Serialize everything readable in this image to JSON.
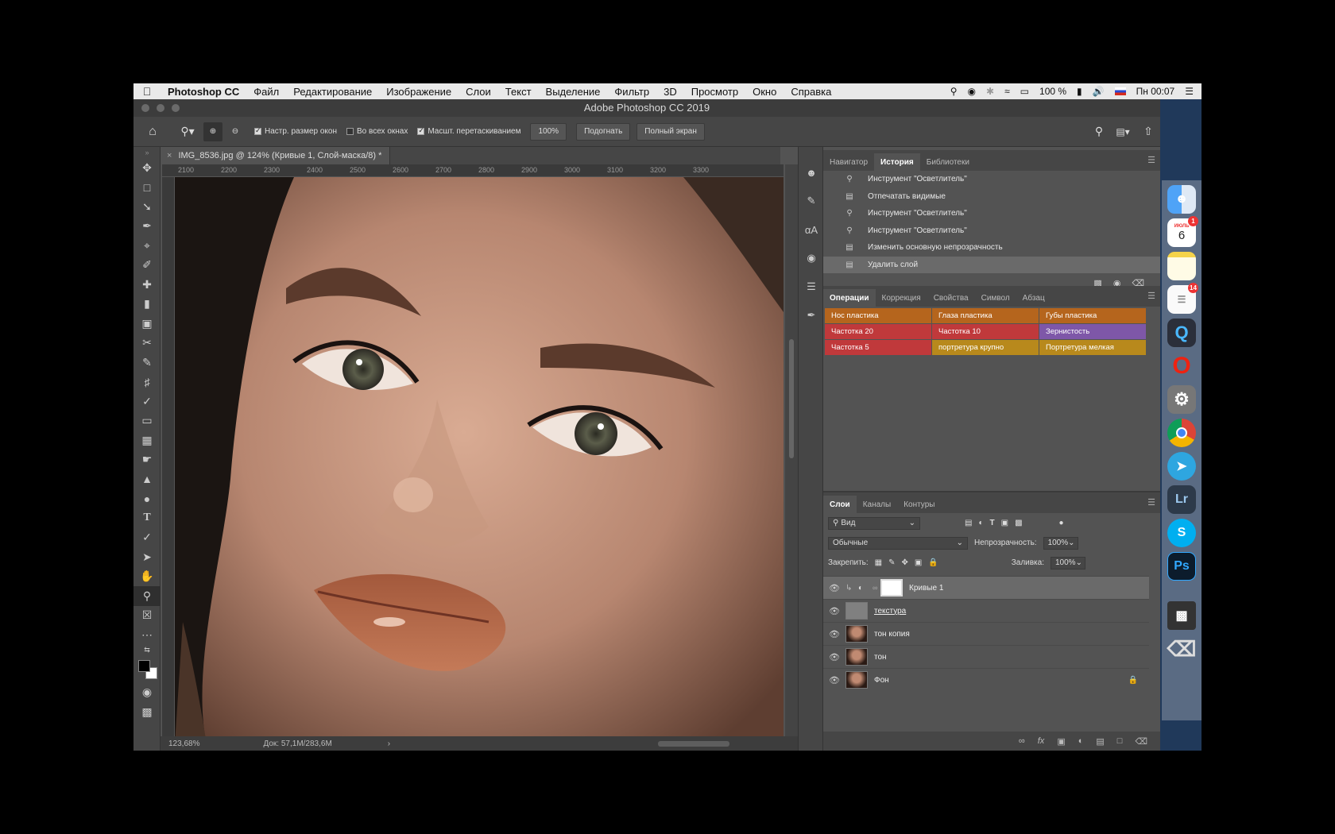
{
  "menubar": {
    "app": "Photoshop CC",
    "items": [
      "Файл",
      "Редактирование",
      "Изображение",
      "Слои",
      "Текст",
      "Выделение",
      "Фильтр",
      "3D",
      "Просмотр",
      "Окно",
      "Справка"
    ],
    "battery": "100 %",
    "clock": "Пн 00:07"
  },
  "window": {
    "title": "Adobe Photoshop CC 2019"
  },
  "options": {
    "resize_windows": "Настр. размер окон",
    "all_windows": "Во всех окнах",
    "scrubby_zoom": "Масшт. перетаскиванием",
    "zoom_value": "100%",
    "fit_label": "Подогнать",
    "fullscreen_label": "Полный экран"
  },
  "document": {
    "tab_title": "IMG_8536.jpg @ 124% (Кривые 1, Слой-маска/8) *",
    "ruler_ticks": [
      "2100",
      "2200",
      "2300",
      "2400",
      "2500",
      "2600",
      "2700",
      "2800",
      "2900",
      "3000",
      "3100",
      "3200",
      "3300"
    ],
    "zoom": "123,68%",
    "doc_info": "Док: 57,1M/283,6M"
  },
  "history_panel": {
    "tabs": [
      "Навигатор",
      "История",
      "Библиотеки"
    ],
    "active_tab": "История",
    "rows": [
      {
        "icon": "brush-tool-icon",
        "label": "Инструмент \"Осветлитель\""
      },
      {
        "icon": "document-icon",
        "label": "Отпечатать видимые"
      },
      {
        "icon": "brush-tool-icon",
        "label": "Инструмент \"Осветлитель\""
      },
      {
        "icon": "brush-tool-icon",
        "label": "Инструмент \"Осветлитель\""
      },
      {
        "icon": "document-icon",
        "label": "Изменить основную непрозрачность"
      },
      {
        "icon": "document-icon",
        "label": "Удалить слой"
      }
    ]
  },
  "actions_panel": {
    "tabs": [
      "Операции",
      "Коррекция",
      "Свойства",
      "Символ",
      "Абзац"
    ],
    "active_tab": "Операции",
    "buttons": [
      {
        "label": "Нос пластика",
        "color": "#b5651d"
      },
      {
        "label": "Глаза пластика",
        "color": "#b5651d"
      },
      {
        "label": "Губы пластика",
        "color": "#b5651d"
      },
      {
        "label": "Частотка 20",
        "color": "#c0393b"
      },
      {
        "label": "Частотка 10",
        "color": "#c0393b"
      },
      {
        "label": "Зернистость",
        "color": "#7e57a8"
      },
      {
        "label": "Частотка 5",
        "color": "#c0393b"
      },
      {
        "label": "портретура крупно",
        "color": "#b8891c"
      },
      {
        "label": "Портретура мелкая",
        "color": "#b8891c"
      }
    ]
  },
  "layers_panel": {
    "tabs": [
      "Слои",
      "Каналы",
      "Контуры"
    ],
    "active_tab": "Слои",
    "filter_label": "Вид",
    "blend_mode": "Обычные",
    "opacity_label": "Непрозрачность:",
    "opacity_value": "100%",
    "lock_label": "Закрепить:",
    "fill_label": "Заливка:",
    "fill_value": "100%",
    "layers": [
      {
        "name": "Кривые 1"
      },
      {
        "name": "текстура"
      },
      {
        "name": "тон копия"
      },
      {
        "name": "тон"
      },
      {
        "name": "Фон"
      }
    ]
  },
  "dock": {
    "calendar_month": "ИЮЛЬ",
    "calendar_day": "6",
    "calendar_badge": "1",
    "reminders_badge": "14",
    "lightroom": "Lr",
    "photoshop": "Ps",
    "skype": "S"
  }
}
